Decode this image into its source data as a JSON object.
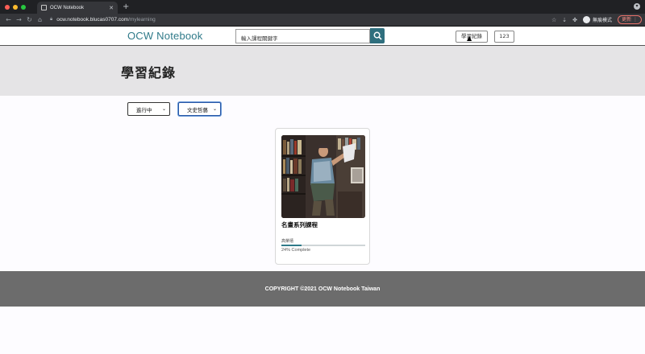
{
  "browser": {
    "tab_title": "OCW Notebook",
    "url_host": "ocw.notebook.blucas0707.com",
    "url_path": "/mylearning",
    "incognito_label": "無痕模式",
    "update_label": "更新"
  },
  "navbar": {
    "brand": "OCW Notebook",
    "search_placeholder": "輸入課程關鍵字",
    "learning_link": "學習紀錄",
    "user_link": "123"
  },
  "page": {
    "title": "學習紀錄"
  },
  "filters": {
    "status_selected": "進行中",
    "category_selected": "文史哲藝"
  },
  "courses": [
    {
      "title": "名畫系列課程",
      "instructor": "高榮禧",
      "progress": 24,
      "progress_text": "24% Complete"
    }
  ],
  "footer": {
    "copyright": "COPYRIGHT ©2021 OCW Notebook Taiwan"
  },
  "colors": {
    "brand": "#2f7a89",
    "search_button": "#2f6f7e",
    "footer": "#6c6c6c"
  }
}
